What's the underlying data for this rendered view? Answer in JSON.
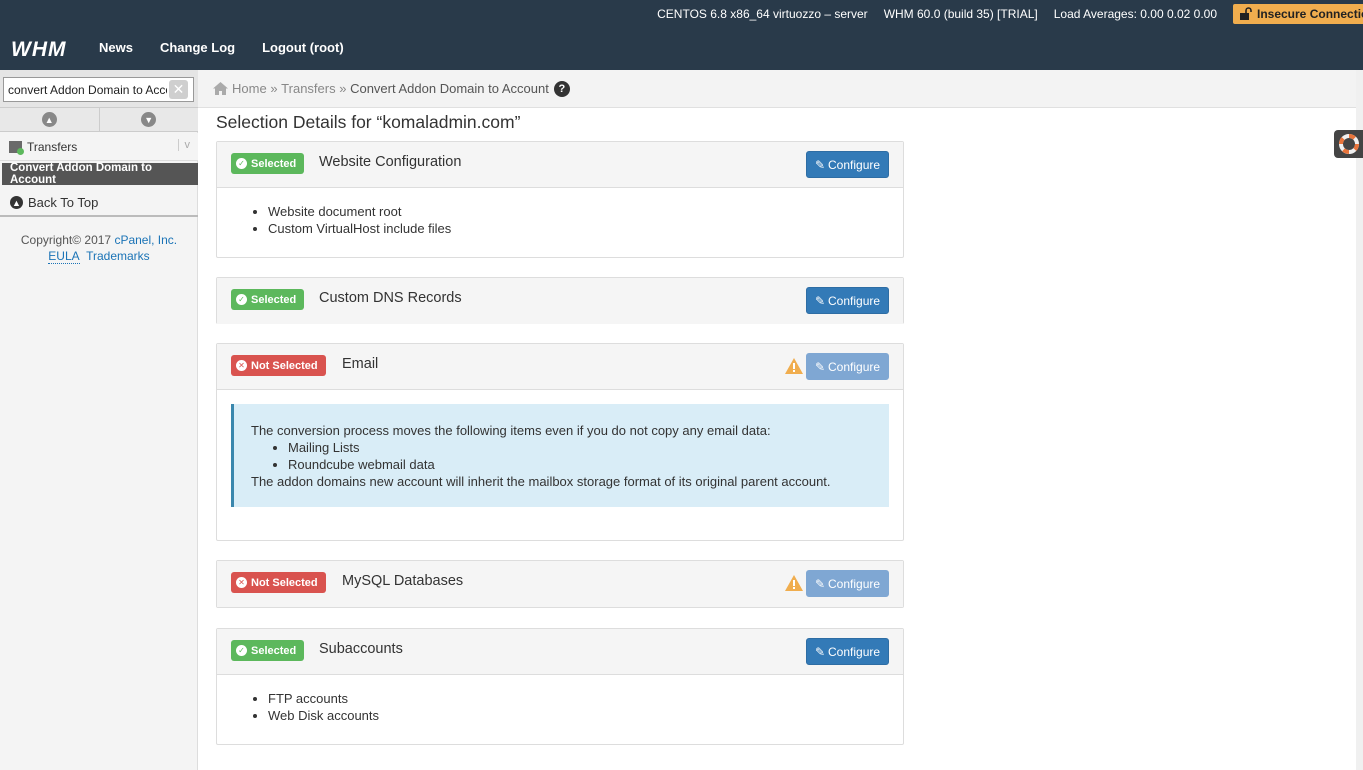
{
  "topbar": {
    "server": "CENTOS 6.8 x86_64 virtuozzo – server",
    "version": "WHM 60.0 (build 35) [TRIAL]",
    "load": "Load Averages: 0.00 0.02 0.00",
    "insecure": "Insecure Connection",
    "logo": "WHM",
    "nav": [
      "News",
      "Change Log",
      "Logout (root)"
    ]
  },
  "sidebar": {
    "search_value": "convert Addon Domain to Account",
    "category": "Transfers",
    "category_chevron": "v",
    "active_item": "Convert Addon Domain to Account",
    "back_to_top": "Back To Top",
    "copyright_prefix": "Copyright© 2017",
    "copyright_link": "cPanel, Inc.",
    "eula": "EULA",
    "trademarks": "Trademarks"
  },
  "breadcrumb": {
    "home": "Home",
    "sep1": "»",
    "transfers": "Transfers",
    "sep2": "»",
    "current": "Convert Addon Domain to Account",
    "help": "?"
  },
  "main": {
    "title": "Selection Details for “komaladmin.com”",
    "configure_label": "Configure",
    "sections": [
      {
        "status": "Selected",
        "title": "Website Configuration",
        "items": [
          "Website document root",
          "Custom VirtualHost include files"
        ]
      },
      {
        "status": "Selected",
        "title": "Custom DNS Records"
      },
      {
        "status": "Not Selected",
        "title": "Email",
        "alert": {
          "intro": "The conversion process moves the following items even if you do not copy any email data:",
          "items": [
            "Mailing Lists",
            "Roundcube webmail data"
          ],
          "outro": "The addon domains new account will inherit the mailbox storage format of its original parent account."
        }
      },
      {
        "status": "Not Selected",
        "title": "MySQL Databases"
      },
      {
        "status": "Selected",
        "title": "Subaccounts",
        "items": [
          "FTP accounts",
          "Web Disk accounts"
        ]
      }
    ]
  },
  "colors": {
    "topbar": "#293a4a",
    "selected": "#5cb85c",
    "not_selected": "#d9534f",
    "primary": "#337ab7",
    "warning": "#f0ad4e"
  }
}
